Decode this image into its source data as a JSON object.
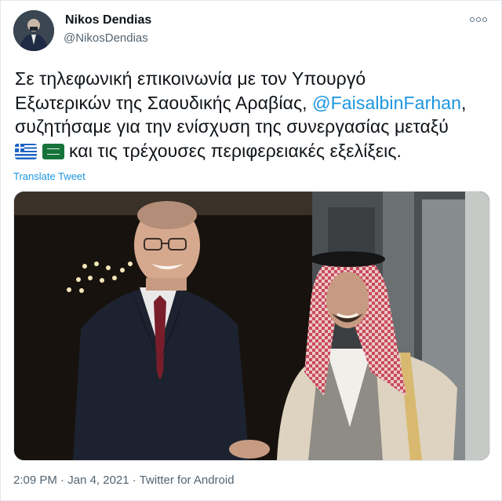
{
  "author": {
    "name": "Nikos Dendias",
    "handle": "@NikosDendias"
  },
  "tweet": {
    "text_line1": "Σε τηλεφωνική επικοινωνία με τον Υπουργό",
    "text_line2_before": "Εξωτερικών της Σαουδικής Αραβίας, ",
    "mention": "@FaisalbinFarhan",
    "text_line2_after": ",",
    "text_line3": "συζητήσαμε για την ενίσχυση της συνεργασίας μεταξύ",
    "text_line4_after_flags": " και τις τρέχουσες περιφερειακές εξελίξεις.",
    "flags": [
      "greece-flag-icon",
      "saudi-arabia-flag-icon"
    ],
    "translate_label": "Translate Tweet"
  },
  "meta": {
    "time": "2:09 PM",
    "separator1": " · ",
    "date": "Jan 4, 2021",
    "separator2": " · ",
    "source": "Twitter for Android"
  },
  "colors": {
    "link": "#1b95e0",
    "secondary_text": "#536471",
    "primary_text": "#0f1419"
  }
}
